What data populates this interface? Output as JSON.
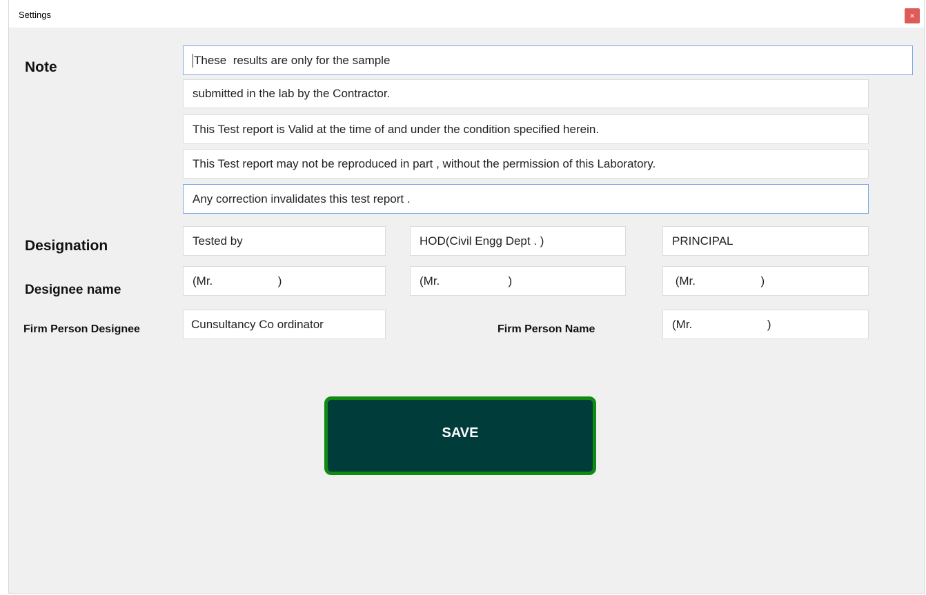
{
  "window": {
    "title": "Settings",
    "close_glyph": "×"
  },
  "labels": {
    "note": "Note",
    "designation": "Designation",
    "designee_name": "Designee name",
    "firm_person_designee": "Firm Person Designee",
    "firm_person_name": "Firm Person Name"
  },
  "notes": [
    "These  results are only for the sample",
    "submitted in the lab by the Contractor.",
    "This Test report is Valid at the time of and under the condition specified herein.",
    "This Test report may not be reproduced in part , without the permission of this Laboratory.",
    "Any correction invalidates this test report ."
  ],
  "designations": [
    "Tested by",
    "HOD(Civil Engg Dept . )",
    "PRINCIPAL"
  ],
  "designee_names": [
    "(Mr.                    )",
    "(Mr.                     )",
    " (Mr.                    )"
  ],
  "firm_person_designee_value": "Cunsultancy Co ordinator",
  "firm_person_name_value": "(Mr.                       )",
  "save_label": "SAVE",
  "colors": {
    "save_fill": "#003d3a",
    "save_border": "#118a14",
    "close_bg": "#e05a5a",
    "focus_border": "#7aa7e8"
  }
}
